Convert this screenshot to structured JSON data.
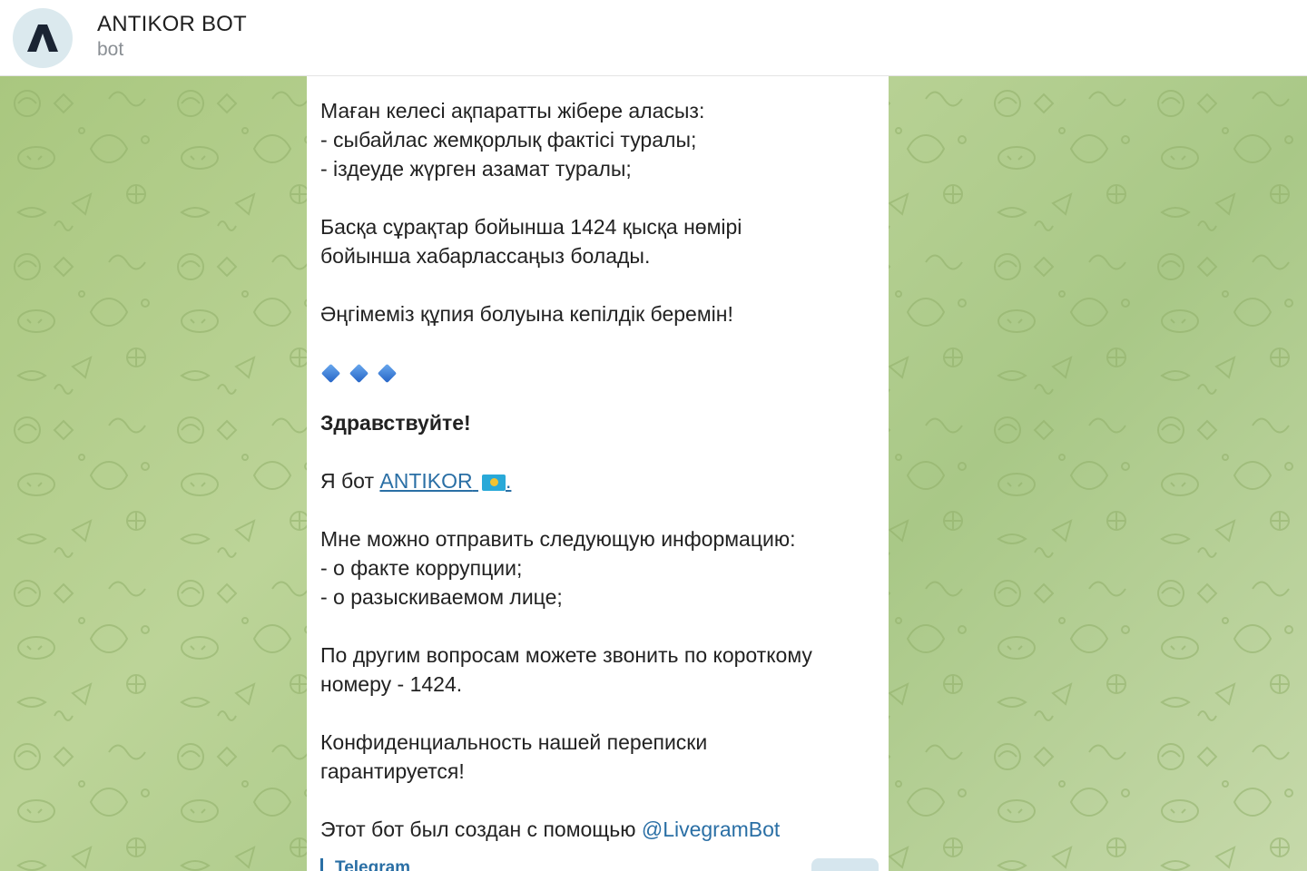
{
  "header": {
    "title": "ANTIKOR BOT",
    "subtitle": "bot",
    "avatar_icon": "antikor-logo-icon"
  },
  "message": {
    "kz_intro": "Маған келесі ақпаратты жібере аласыз:",
    "kz_item1": "- сыбайлас жемқорлық фактісі туралы;",
    "kz_item2": "- іздеуде жүрген азамат туралы;",
    "kz_other_line1": "Басқа сұрақтар бойынша 1424 қысқа нөмірі",
    "kz_other_line2": "бойынша хабарлассаңыз болады.",
    "kz_confidential": "Әңгімеміз құпия болуына кепілдік беремін!",
    "divider_icon": "blue-diamonds-icon",
    "ru_greeting": "Здравствуйте!",
    "ru_bot_prefix": "Я бот ",
    "ru_bot_link": "ANTIKOR",
    "ru_bot_link_suffix": ".",
    "flag_icon": "kazakhstan-flag-icon",
    "ru_intro": "Мне можно отправить следующую информацию:",
    "ru_item1": "- о факте коррупции;",
    "ru_item2": "- о разыскиваемом лице;",
    "ru_other_line1": "По другим вопросам можете звонить по короткому",
    "ru_other_line2": "номеру - 1424.",
    "ru_confidential_line1": "Конфиденциальность нашей переписки",
    "ru_confidential_line2": "гарантируется!",
    "footer_prefix": "Этот бот был создан с помощью ",
    "footer_link": "@LivegramBot",
    "preview_source": "Telegram"
  },
  "colors": {
    "accent": "#2a6fa5",
    "chat_background": "#b7cf94",
    "bubble": "#ffffff"
  }
}
